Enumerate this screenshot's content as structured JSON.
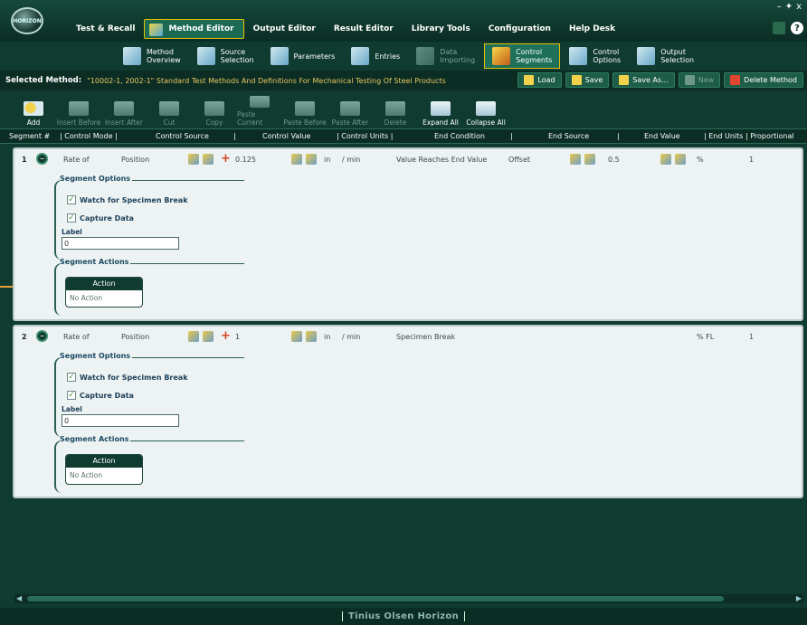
{
  "window": {
    "minimize_icon": "minimize-icon",
    "close_label": "x",
    "help_label": "?"
  },
  "main_tabs": [
    {
      "label": "Test & Recall"
    },
    {
      "label": "Method Editor",
      "active": true
    },
    {
      "label": "Output Editor"
    },
    {
      "label": "Result Editor"
    },
    {
      "label": "Library Tools"
    },
    {
      "label": "Configuration"
    },
    {
      "label": "Help Desk"
    }
  ],
  "sub_tabs": [
    {
      "label": "Method\nOverview",
      "state": "normal"
    },
    {
      "label": "Source\nSelection",
      "state": "normal"
    },
    {
      "label": "Parameters",
      "state": "normal"
    },
    {
      "label": "Entries",
      "state": "normal"
    },
    {
      "label": "Data\nImporting",
      "state": "disabled"
    },
    {
      "label": "Control\nSegments",
      "state": "active"
    },
    {
      "label": "Control\nOptions",
      "state": "normal"
    },
    {
      "label": "Output\nSelection",
      "state": "normal"
    }
  ],
  "method": {
    "label": "Selected Method:",
    "value": "\"10002-1, 2002-1\" Standard Test Methods And Definitions For Mechanical Testing Of Steel Products",
    "buttons": [
      {
        "label": "Load",
        "state": "normal"
      },
      {
        "label": "Save",
        "state": "normal"
      },
      {
        "label": "Save As...",
        "state": "normal"
      },
      {
        "label": "New",
        "state": "disabled"
      },
      {
        "label": "Delete Method",
        "state": "danger"
      }
    ]
  },
  "toolbar": [
    {
      "label": "Add",
      "state": "normal",
      "kind": "add"
    },
    {
      "label": "Insert Before",
      "state": "disabled"
    },
    {
      "label": "Insert After",
      "state": "disabled"
    },
    {
      "label": "Cut",
      "state": "disabled"
    },
    {
      "label": "Copy",
      "state": "disabled"
    },
    {
      "label": "Paste Current",
      "state": "disabled"
    },
    {
      "label": "Paste Before",
      "state": "disabled"
    },
    {
      "label": "Paste After",
      "state": "disabled"
    },
    {
      "label": "Delete",
      "state": "disabled"
    },
    {
      "label": "Expand All",
      "state": "normal"
    },
    {
      "label": "Collapse All",
      "state": "normal"
    }
  ],
  "columns": {
    "segment": "Segment #",
    "control_mode": "| Control Mode |",
    "control_source": "Control Source",
    "sep1": "|",
    "control_value": "Control Value",
    "control_units": "| Control Units |",
    "end_condition": "End Condition",
    "sep2": "|",
    "end_source": "End Source",
    "sep3": "|",
    "end_value": "End Value",
    "end_units": "| End Units | Proportional"
  },
  "segments": [
    {
      "number": "1",
      "control_mode": "Rate of",
      "control_source": "Position",
      "control_value": "0.125",
      "unit_a": "in",
      "unit_b": "/  min",
      "end_condition": "Value Reaches End Value",
      "end_source": "Offset",
      "end_value": "0.5",
      "end_units": "%",
      "proportional": "1",
      "options_title": "Segment Options",
      "watch_break": "Watch for Specimen Break",
      "capture_data": "Capture Data",
      "label_caption": "Label",
      "label_value": "0",
      "actions_title": "Segment Actions",
      "action_header": "Action",
      "action_value": "No Action"
    },
    {
      "number": "2",
      "control_mode": "Rate of",
      "control_source": "Position",
      "control_value": "1",
      "unit_a": "in",
      "unit_b": "/  min",
      "end_condition": "Specimen Break",
      "end_source": "",
      "end_value": "",
      "end_units": "% FL",
      "proportional": "1",
      "options_title": "Segment Options",
      "watch_break": "Watch for Specimen Break",
      "capture_data": "Capture Data",
      "label_caption": "Label",
      "label_value": "0",
      "actions_title": "Segment Actions",
      "action_header": "Action",
      "action_value": "No Action"
    }
  ],
  "footer": {
    "brand": "Tinius Olsen Horizon"
  },
  "logo_text": "HORIZON"
}
